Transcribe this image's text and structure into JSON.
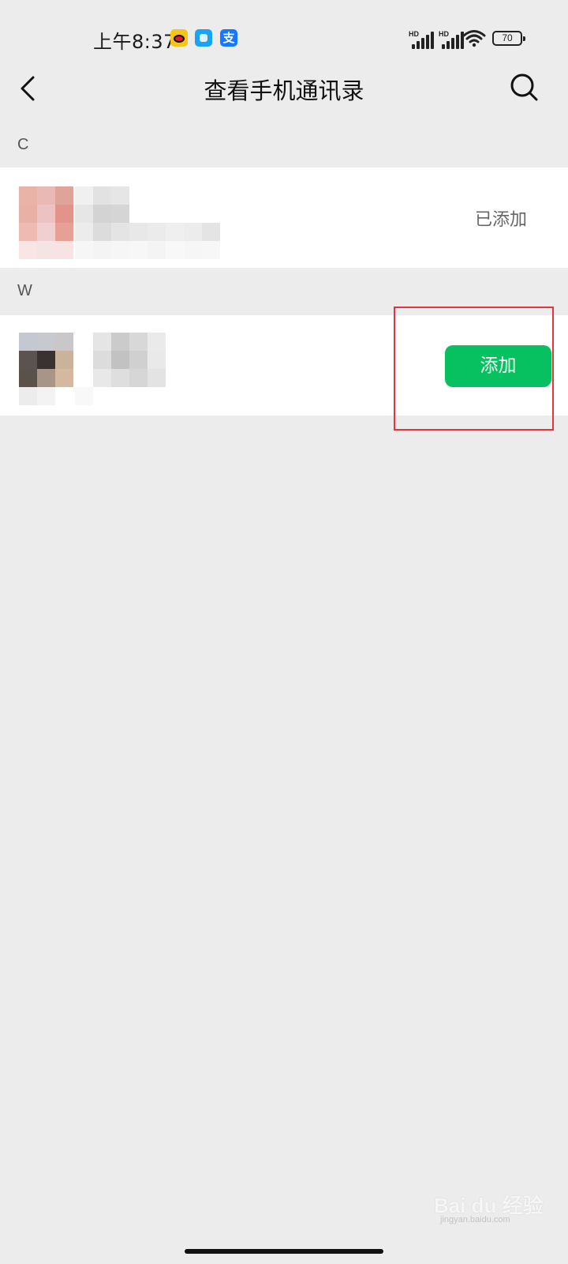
{
  "status_bar": {
    "time": "上午8:37",
    "icons": [
      "weibo-icon",
      "app-icon",
      "alipay-icon"
    ],
    "alipay_glyph": "支",
    "signal_label": "HD",
    "battery": "70"
  },
  "nav": {
    "title": "查看手机通讯录",
    "back_icon": "chevron-left-icon",
    "search_icon": "search-icon"
  },
  "sections": [
    {
      "letter": "C",
      "contacts": [
        {
          "status": "已添加",
          "action": null
        }
      ]
    },
    {
      "letter": "W",
      "contacts": [
        {
          "status": null,
          "action": "添加"
        }
      ]
    }
  ],
  "colors": {
    "accent_green": "#07c160",
    "highlight_red": "#e8323c",
    "background": "#ececec"
  },
  "watermark": {
    "text": "Bai du 经验",
    "sub": "jingyan.baidu.com"
  }
}
